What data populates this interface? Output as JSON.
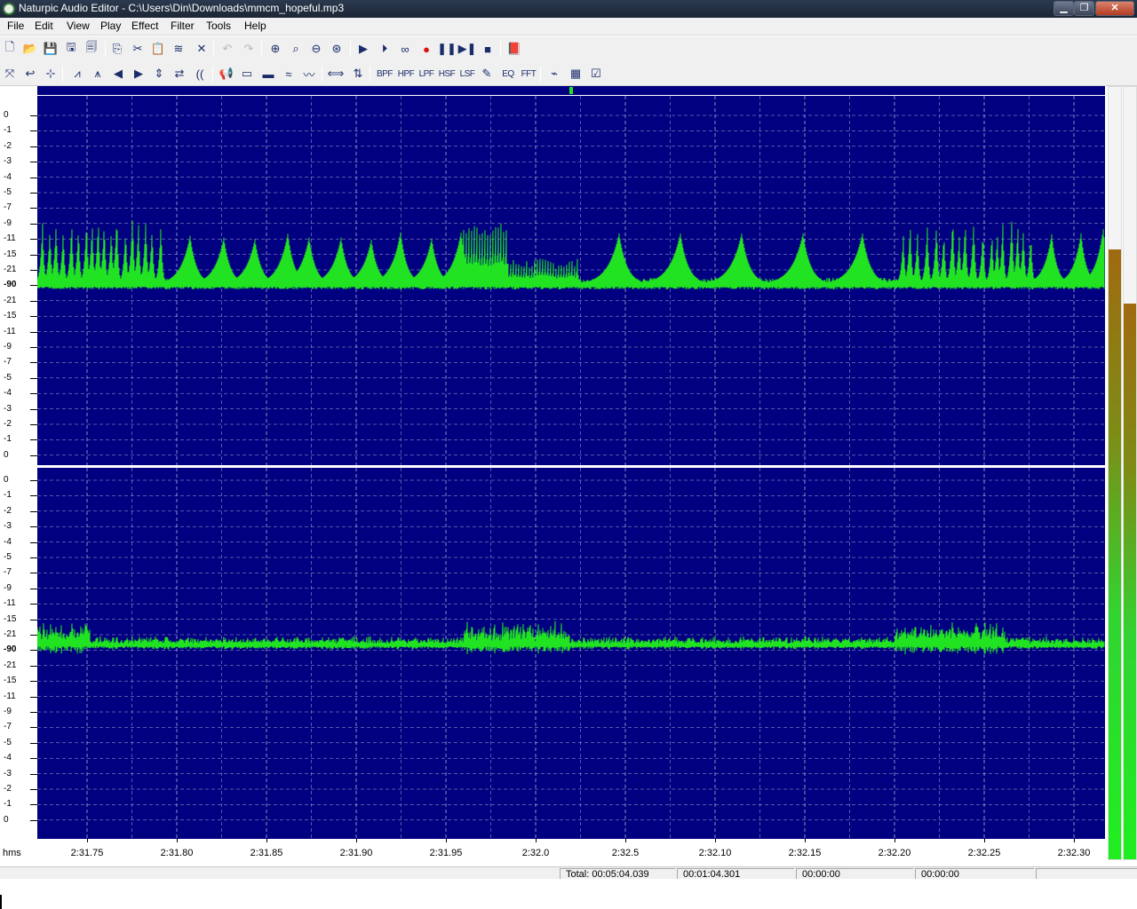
{
  "window": {
    "title": "Naturpic Audio Editor - C:\\Users\\Din\\Downloads\\mmcm_hopeful.mp3",
    "minimize_glyph": "▁",
    "maximize_glyph": "❐",
    "close_glyph": "✕"
  },
  "menu": [
    "File",
    "Edit",
    "View",
    "Play",
    "Effect",
    "Filter",
    "Tools",
    "Help"
  ],
  "toolbar1": [
    {
      "icon": "new-file-icon",
      "glyph": "🗋"
    },
    {
      "icon": "open-folder-icon",
      "glyph": "📂"
    },
    {
      "icon": "save-icon",
      "glyph": "💾"
    },
    {
      "icon": "save-as-icon",
      "glyph": "🖫"
    },
    {
      "icon": "properties-icon",
      "glyph": "🗐"
    },
    {
      "icon": "copy-icon",
      "glyph": "⎘"
    },
    {
      "icon": "cut-icon",
      "glyph": "✂"
    },
    {
      "icon": "paste-icon",
      "glyph": "📋",
      "disabled": true
    },
    {
      "icon": "mix-paste-icon",
      "glyph": "≋"
    },
    {
      "icon": "delete-icon",
      "glyph": "✕"
    },
    {
      "icon": "undo-icon",
      "glyph": "↶",
      "disabled": true
    },
    {
      "icon": "redo-icon",
      "glyph": "↷",
      "disabled": true
    },
    {
      "icon": "zoom-in-icon",
      "glyph": "⊕"
    },
    {
      "icon": "zoom-selection-icon",
      "glyph": "⌕"
    },
    {
      "icon": "zoom-out-icon",
      "glyph": "⊖"
    },
    {
      "icon": "zoom-full-icon",
      "glyph": "⊛"
    },
    {
      "icon": "play-icon",
      "glyph": "▶"
    },
    {
      "icon": "play-selection-icon",
      "glyph": "⏵"
    },
    {
      "icon": "loop-icon",
      "glyph": "∞"
    },
    {
      "icon": "record-icon",
      "glyph": "●",
      "red": true
    },
    {
      "icon": "pause-icon",
      "glyph": "❚❚"
    },
    {
      "icon": "step-forward-icon",
      "glyph": "▶❚"
    },
    {
      "icon": "stop-icon",
      "glyph": "■"
    },
    {
      "icon": "help-book-icon",
      "glyph": "📕"
    }
  ],
  "toolbar2": [
    {
      "icon": "select-all-icon",
      "glyph": "⤧"
    },
    {
      "icon": "back-icon",
      "glyph": "↩"
    },
    {
      "icon": "split-icon",
      "glyph": "⊹"
    },
    {
      "icon": "amplify-icon",
      "glyph": "⩘"
    },
    {
      "icon": "normalize-icon",
      "glyph": "⩚"
    },
    {
      "icon": "fade-in-icon",
      "glyph": "◀"
    },
    {
      "icon": "fade-out-icon",
      "glyph": "▶"
    },
    {
      "icon": "invert-icon",
      "glyph": "⇕"
    },
    {
      "icon": "reverse-icon",
      "glyph": "⇄"
    },
    {
      "icon": "echo-icon",
      "glyph": "(("
    },
    {
      "icon": "noise-icon",
      "glyph": "📢"
    },
    {
      "icon": "silence-icon",
      "glyph": "▭"
    },
    {
      "icon": "insert-silence-icon",
      "glyph": "▬"
    },
    {
      "icon": "vibrato-icon",
      "glyph": "≈"
    },
    {
      "icon": "chorus-icon",
      "glyph": "〰"
    },
    {
      "icon": "stretch-icon",
      "glyph": "⟺"
    },
    {
      "icon": "pitch-icon",
      "glyph": "⇅"
    }
  ],
  "filters": [
    "BPF",
    "HPF",
    "LPF",
    "HSF",
    "LSF"
  ],
  "toolbar2_tail": [
    {
      "icon": "pencil-icon",
      "glyph": "✎"
    },
    {
      "icon": "equalizer-icon",
      "glyph": "EQ"
    },
    {
      "icon": "fft-icon",
      "glyph": "FFT"
    },
    {
      "icon": "envelope-edit-icon",
      "glyph": "⌁"
    },
    {
      "icon": "effect-chain-icon",
      "glyph": "▦"
    },
    {
      "icon": "batch-edit-icon",
      "glyph": "☑"
    }
  ],
  "db_scale_top": [
    "0",
    "-1",
    "-2",
    "-3",
    "-4",
    "-5",
    "-7",
    "-9",
    "-11",
    "-15",
    "-21",
    "-90",
    "-21",
    "-15",
    "-11",
    "-9",
    "-7",
    "-5",
    "-4",
    "-3",
    "-2",
    "-1",
    "0"
  ],
  "db_scale_bottom": [
    "0",
    "-1",
    "-2",
    "-3",
    "-4",
    "-5",
    "-7",
    "-9",
    "-11",
    "-15",
    "-21",
    "-90",
    "-21",
    "-15",
    "-11",
    "-9",
    "-7",
    "-5",
    "-4",
    "-3",
    "-2",
    "-1",
    "0"
  ],
  "time_unit": "hms",
  "time_labels": [
    "2:31.75",
    "2:31.80",
    "2:31.85",
    "2:31.90",
    "2:31.95",
    "2:32.0",
    "2:32.5",
    "2:32.10",
    "2:32.15",
    "2:32.20",
    "2:32.25",
    "2:32.30"
  ],
  "status": {
    "total": "Total: 00:05:04.039",
    "position": "00:01:04.301",
    "sel_start": "00:00:00",
    "sel_end": "00:00:00"
  },
  "meters": {
    "left_level": 0.79,
    "right_level": 0.72
  },
  "colors": {
    "waveform_bg": "#000080",
    "waveform": "#21e321",
    "gridline": "#b0b0d8",
    "center_line": "#c04040"
  }
}
